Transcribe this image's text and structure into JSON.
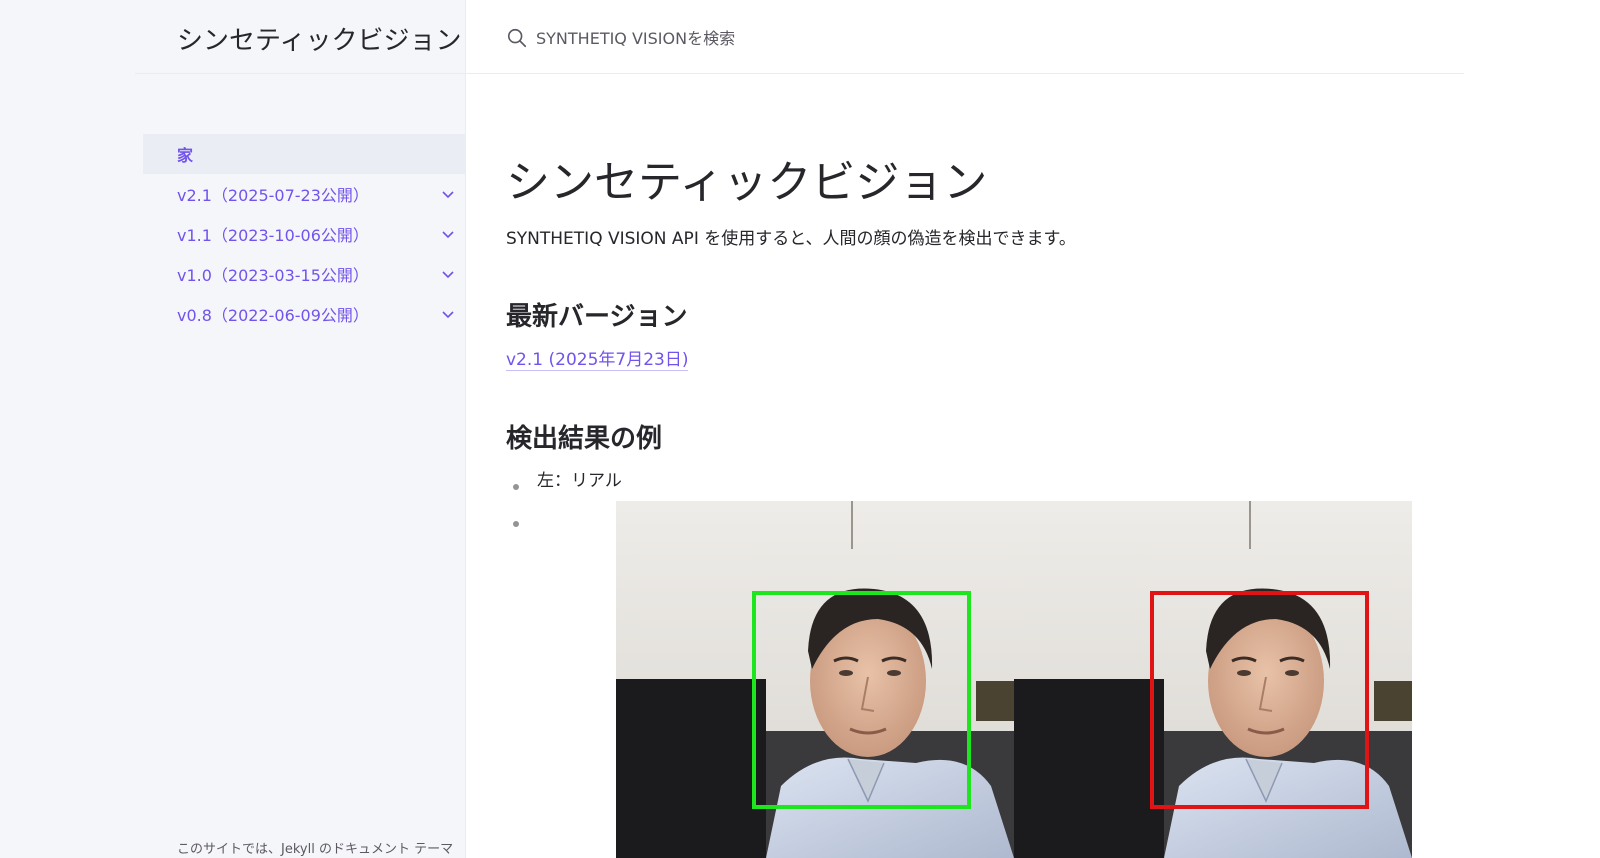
{
  "site": {
    "title": "シンセティックビジョン",
    "footer_note": "このサイトでは、Jekyll のドキュメント テーマ"
  },
  "search": {
    "placeholder": "SYNTHETIQ VISIONを検索",
    "icon": "search-icon"
  },
  "nav": {
    "items": [
      {
        "label": "家",
        "active": true
      },
      {
        "label": "v2.1（2025-07-23公開）",
        "expandable": true
      },
      {
        "label": "v1.1（2023-10-06公開）",
        "expandable": true
      },
      {
        "label": "v1.0（2023-03-15公開）",
        "expandable": true
      },
      {
        "label": "v0.8（2022-06-09公開）",
        "expandable": true
      }
    ]
  },
  "main": {
    "title": "シンセティックビジョン",
    "intro": "SYNTHETIQ VISION API を使用すると、人間の顔の偽造を検出できます。",
    "latest_heading": "最新バージョン",
    "latest_link": "v2.1 (2025年7月23日)",
    "examples_heading": "検出結果の例",
    "example_items": [
      "左：リアル",
      ""
    ],
    "figure": {
      "left_box_color": "#1ee61e",
      "right_box_color": "#e01414"
    }
  },
  "colors": {
    "accent": "#7253ed",
    "sidebar_bg": "#f5f6fa",
    "active_bg": "#ebedf5"
  }
}
